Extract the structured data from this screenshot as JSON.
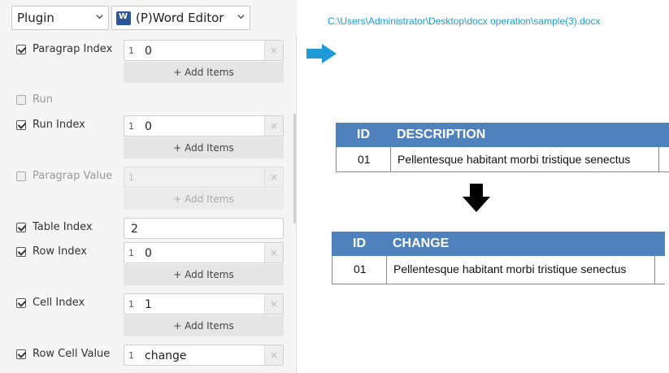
{
  "toolbar": {
    "plugin_select": "Plugin",
    "editor_select": "(P)Word Editor"
  },
  "rows": {
    "paragraph_index": {
      "label": "Paragrap Index",
      "index": "1",
      "value": "0",
      "clear": "×",
      "add": "+ Add Items"
    },
    "run": {
      "label": "Run"
    },
    "run_index": {
      "label": "Run Index",
      "index": "1",
      "value": "0",
      "clear": "×",
      "add": "+ Add Items"
    },
    "paragraph_value": {
      "label": "Paragrap Value",
      "index": "1",
      "value": "",
      "clear": "×",
      "add": "+ Add Items"
    },
    "table_index": {
      "label": "Table Index",
      "value": "2"
    },
    "row_index": {
      "label": "Row Index",
      "index": "1",
      "value": "0",
      "clear": "×",
      "add": "+ Add Items"
    },
    "cell_index": {
      "label": "Cell Index",
      "index": "1",
      "value": "1",
      "clear": "×",
      "add": "+ Add Items"
    },
    "row_cell_value": {
      "label": "Row Cell Value",
      "index": "1",
      "value": "change",
      "clear": "×"
    }
  },
  "file_path": "C:\\Users\\Administrator\\Desktop\\docx operation\\sample(3).docx",
  "table_before": {
    "headers": [
      "ID",
      "DESCRIPTION"
    ],
    "row": [
      "01",
      "Pellentesque habitant morbi tristique senectus"
    ]
  },
  "table_after": {
    "headers": [
      "ID",
      "CHANGE"
    ],
    "row": [
      "01",
      "Pellentesque habitant morbi tristique senectus"
    ]
  },
  "colors": {
    "table_header": "#4f81bd",
    "path_text": "#1e9bd7",
    "arrow_right": "#1e9bd7",
    "arrow_down": "#000000"
  },
  "icons": {
    "word": "word-icon",
    "arrow_right": "arrow-right-icon",
    "arrow_down": "arrow-down-icon"
  }
}
